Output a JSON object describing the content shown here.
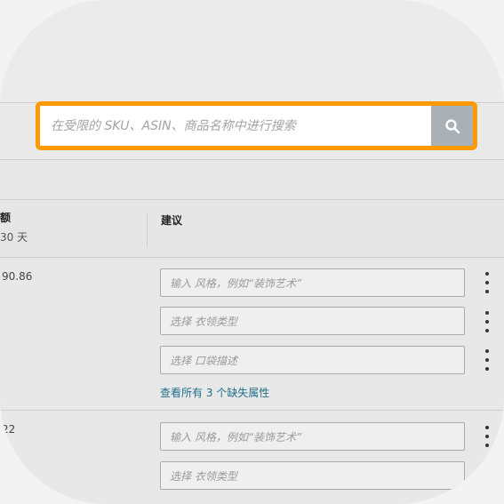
{
  "search": {
    "placeholder": "在受限的 SKU、ASIN、商品名称中进行搜索",
    "button_icon": "search-icon",
    "border_color": "#ff9900"
  },
  "table": {
    "headers": {
      "left_title": "额",
      "left_sub": "30 天",
      "suggest": "建议"
    },
    "rows": [
      {
        "value": "90.86",
        "fields": [
          "输入 风格，例如“装饰艺术”",
          "选择 衣领类型",
          "选择 口袋描述"
        ],
        "link": "查看所有 3 个缺失属性"
      },
      {
        "value": "22",
        "fields": [
          "输入 风格，例如“装饰艺术”",
          "选择 衣领类型"
        ]
      }
    ]
  }
}
